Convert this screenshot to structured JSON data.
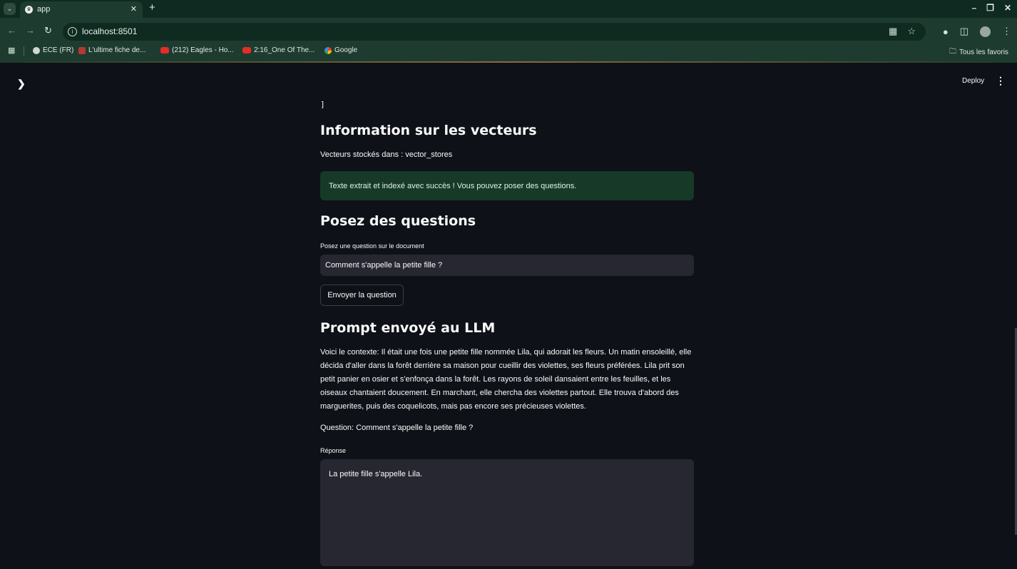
{
  "browser": {
    "tab_title": "app",
    "url": "localhost:8501",
    "bookmarks": [
      {
        "label": "ECE (FR)",
        "icon": "globe-icon"
      },
      {
        "label": "L'ultime fiche de...",
        "icon": "folder-icon"
      },
      {
        "label": "(212) Eagles - Ho...",
        "icon": "youtube-icon"
      },
      {
        "label": "2:16_One Of The...",
        "icon": "youtube-icon"
      },
      {
        "label": "Google",
        "icon": "google-icon"
      }
    ],
    "all_bookmarks_label": "Tous les favoris"
  },
  "header": {
    "deploy_label": "Deploy"
  },
  "json_tail": "]",
  "vectors": {
    "heading": "Information sur les vecteurs",
    "stored_text": "Vecteurs stockés dans : vector_stores",
    "success_message": "Texte extrait et indexé avec succès ! Vous pouvez poser des questions."
  },
  "questions": {
    "heading": "Posez des questions",
    "input_label": "Posez une question sur le document",
    "input_value": "Comment s'appelle la petite fille ?",
    "send_button": "Envoyer la question"
  },
  "prompt": {
    "heading": "Prompt envoyé au LLM",
    "context": "Voici le contexte: Il était une fois une petite fille nommée Lila, qui adorait les fleurs. Un matin ensoleillé, elle décida d'aller dans la forêt derrière sa maison pour cueillir des violettes, ses fleurs préférées. Lila prit son petit panier en osier et s'enfonça dans la forêt. Les rayons de soleil dansaient entre les feuilles, et les oiseaux chantaient doucement. En marchant, elle chercha des violettes partout. Elle trouva d'abord des marguerites, puis des coquelicots, mais pas encore ses précieuses violettes.",
    "question_line": "Question: Comment s'appelle la petite fille ?",
    "response_label": "Réponse",
    "response_value": "La petite fille s'appelle Lila."
  },
  "colors": {
    "app_background": "#0e1117",
    "input_background": "#262730",
    "success_background": "#173928",
    "chrome_background": "#1e3b2f"
  }
}
